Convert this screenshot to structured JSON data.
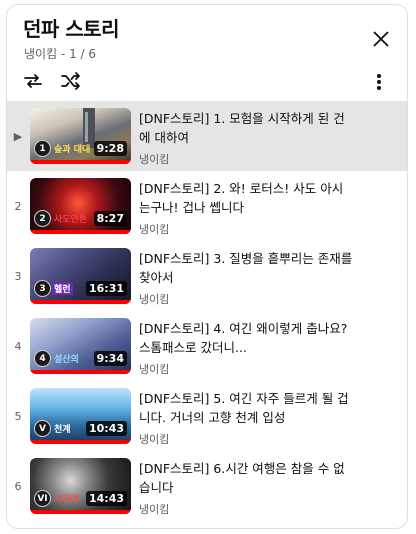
{
  "playlist": {
    "title": "던파 스토리",
    "subtitle": "냉이킴 - 1 / 6"
  },
  "icons": {
    "close": "close-icon",
    "loop": "loop-icon",
    "shuffle": "shuffle-icon",
    "more": "more-vertical-icon",
    "playing": "play-triangle-icon"
  },
  "colors": {
    "progress": "#ff0000",
    "active_row": "#e5e5e5"
  },
  "items": [
    {
      "index": "▶",
      "title": "[DNF스토리] 1. 모험을 시작하게 된 건에 대하여",
      "channel": "냉이킴",
      "duration": "9:28",
      "badge": "1",
      "caption": "숲과 대대"
    },
    {
      "index": "2",
      "title": "[DNF스토리] 2. 와! 로터스! 사도 아시는구나! 겁나 쎕니다",
      "channel": "냉이킴",
      "duration": "8:27",
      "badge": "2",
      "caption": "사도안톤"
    },
    {
      "index": "3",
      "title": "[DNF스토리] 3. 질병을 흩뿌리는 존재를 찾아서",
      "channel": "냉이킴",
      "duration": "16:31",
      "badge": "3",
      "caption": "헬런"
    },
    {
      "index": "4",
      "title": "[DNF스토리] 4. 여긴 왜이렇게 춥나요? 스톰패스로 갔더니...",
      "channel": "냉이킴",
      "duration": "9:34",
      "badge": "4",
      "caption": "설산의"
    },
    {
      "index": "5",
      "title": "[DNF스토리] 5. 여긴 자주 들르게 될 겁니다. 거너의 고향 천계 입성",
      "channel": "냉이킴",
      "duration": "10:43",
      "badge": "V",
      "caption": "천계"
    },
    {
      "index": "6",
      "title": "[DNF스토리] 6.시간 여행은 참을 수 없습니다",
      "channel": "냉이킴",
      "duration": "14:43",
      "badge": "VI",
      "caption": "시간여"
    }
  ]
}
